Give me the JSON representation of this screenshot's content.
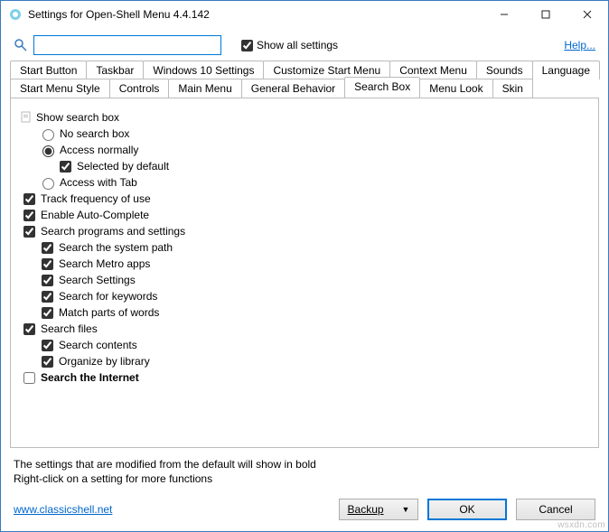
{
  "window": {
    "title": "Settings for Open-Shell Menu 4.4.142"
  },
  "toolbar": {
    "show_all": "Show all settings",
    "help": "Help..."
  },
  "tabs_row1": [
    "Start Button",
    "Taskbar",
    "Windows 10 Settings",
    "Customize Start Menu",
    "Context Menu",
    "Sounds",
    "Language"
  ],
  "tabs_row2": [
    "Start Menu Style",
    "Controls",
    "Main Menu",
    "General Behavior",
    "Search Box",
    "Menu Look",
    "Skin"
  ],
  "active_tab": "Search Box",
  "tree": {
    "group": "Show search box",
    "radios": {
      "none": "No search box",
      "normal": "Access normally",
      "tab": "Access with Tab"
    },
    "selected_default": "Selected by default",
    "track": "Track frequency of use",
    "autocomplete": "Enable Auto-Complete",
    "progs": {
      "label": "Search programs and settings",
      "syspath": "Search the system path",
      "metro": "Search Metro apps",
      "settings": "Search Settings",
      "keywords": "Search for keywords",
      "match": "Match parts of words"
    },
    "files": {
      "label": "Search files",
      "contents": "Search contents",
      "organize": "Organize by library"
    },
    "internet": "Search the Internet"
  },
  "hints": {
    "line1": "The settings that are modified from the default will show in bold",
    "line2": "Right-click on a setting for more functions"
  },
  "footer": {
    "url": "www.classicshell.net",
    "backup": "Backup",
    "ok": "OK",
    "cancel": "Cancel"
  },
  "watermark": "wsxdn.com"
}
